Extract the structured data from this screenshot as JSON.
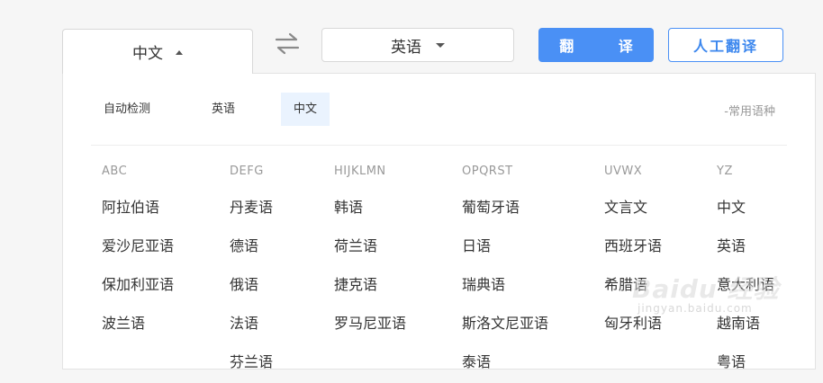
{
  "source_lang": {
    "label": "中文"
  },
  "target_lang": {
    "label": "英语"
  },
  "buttons": {
    "translate": "翻  译",
    "human": "人工翻译"
  },
  "common": {
    "items": [
      "自动检测",
      "英语",
      "中文"
    ],
    "active": "中文",
    "label": "-常用语种"
  },
  "columns": [
    {
      "header": "ABC",
      "items": [
        "阿拉伯语",
        "爱沙尼亚语",
        "保加利亚语",
        "波兰语"
      ]
    },
    {
      "header": "DEFG",
      "items": [
        "丹麦语",
        "德语",
        "俄语",
        "法语",
        "芬兰语"
      ]
    },
    {
      "header": "HIJKLMN",
      "items": [
        "韩语",
        "荷兰语",
        "捷克语",
        "罗马尼亚语"
      ]
    },
    {
      "header": "OPQRST",
      "items": [
        "葡萄牙语",
        "日语",
        "瑞典语",
        "斯洛文尼亚语",
        "泰语"
      ]
    },
    {
      "header": "UVWX",
      "items": [
        "文言文",
        "西班牙语",
        "希腊语",
        "匈牙利语"
      ]
    },
    {
      "header": "YZ",
      "items": [
        "中文",
        "英语",
        "意大利语",
        "越南语",
        "粤语"
      ]
    }
  ],
  "watermark": {
    "main": "Baidu 经验",
    "sub": "jingyan.baidu.com"
  },
  "icons": {
    "source_caret": "caret-up-icon",
    "target_caret": "caret-down-icon",
    "swap": "swap-arrows-icon"
  },
  "colors": {
    "accent": "#4a90f5",
    "active_chip_bg": "#eaf3fe"
  }
}
